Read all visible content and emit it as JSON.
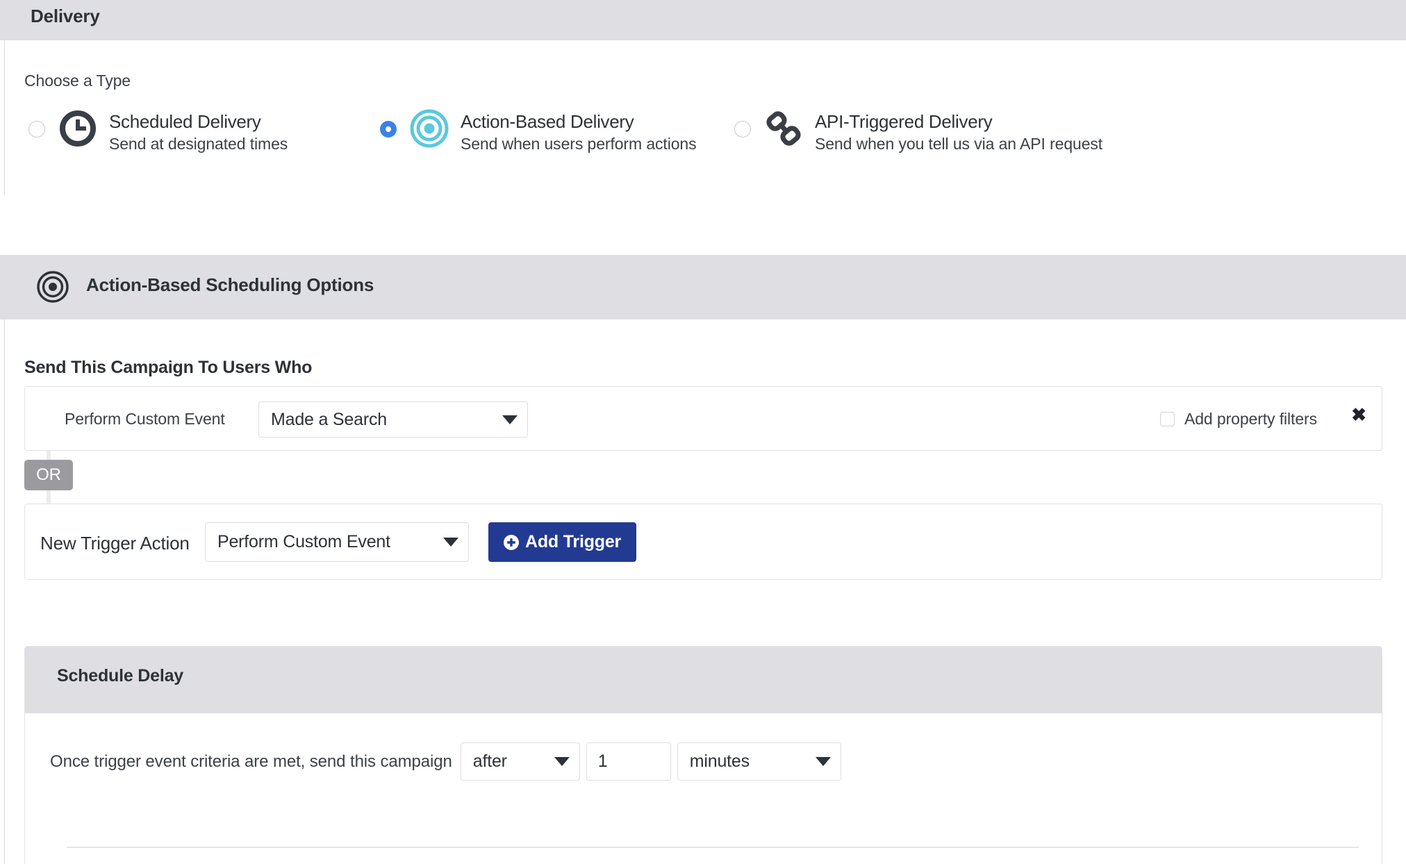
{
  "header": {
    "title": "Delivery",
    "accent_color": "#2b3990"
  },
  "choose_type": {
    "label": "Choose a Type",
    "options": [
      {
        "id": "scheduled",
        "title": "Scheduled Delivery",
        "description": "Send at designated times",
        "icon": "clock-icon",
        "icon_color": "#3a3f45",
        "selected": false
      },
      {
        "id": "action-based",
        "title": "Action-Based Delivery",
        "description": "Send when users perform actions",
        "icon": "target-icon",
        "icon_color": "#5bc8dd",
        "selected": true
      },
      {
        "id": "api-triggered",
        "title": "API-Triggered Delivery",
        "description": "Send when you tell us via an API request",
        "icon": "chain-link-icon",
        "icon_color": "#3a3f45",
        "selected": false
      }
    ],
    "selected_radio_color": "#3b82e8"
  },
  "scheduling_options": {
    "header_title": "Action-Based Scheduling Options",
    "header_icon": "target-icon",
    "send_to_label": "Send This Campaign To Users Who",
    "triggers": [
      {
        "label": "Perform Custom Event",
        "event_value": "Made a Search",
        "property_filters_label": "Add property filters",
        "property_filters_checked": false,
        "remove_icon": "close-icon"
      }
    ],
    "or_badge": "OR",
    "new_trigger": {
      "label": "New Trigger Action",
      "action_value": "Perform Custom Event",
      "add_button_label": "Add Trigger",
      "add_button_icon": "plus-circle-icon",
      "add_button_color": "#233a92"
    }
  },
  "schedule_delay": {
    "title": "Schedule Delay",
    "sentence": "Once trigger event criteria are met, send this campaign",
    "timing_value": "after",
    "amount_value": "1",
    "amount_placeholder": "",
    "unit_value": "minutes"
  }
}
